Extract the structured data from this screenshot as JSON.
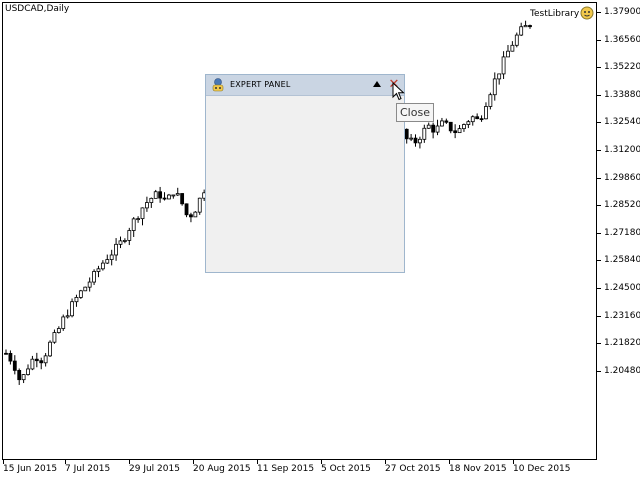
{
  "chart": {
    "symbol": "USDCAD,Daily",
    "expert_name": "TestLibrary",
    "price_labels": [
      "1.37900",
      "1.36560",
      "1.35220",
      "1.33880",
      "1.32540",
      "1.31200",
      "1.29860",
      "1.28520",
      "1.27180",
      "1.25840",
      "1.24500",
      "1.23160",
      "1.21820",
      "1.20480"
    ],
    "time_labels": [
      "15 Jun 2015",
      "7 Jul 2015",
      "29 Jul 2015",
      "20 Aug 2015",
      "11 Sep 2015",
      "5 Oct 2015",
      "27 Oct 2015",
      "18 Nov 2015",
      "10 Dec 2015"
    ],
    "colors": {
      "candle": "#000000",
      "background": "#ffffff"
    }
  },
  "chart_data": {
    "type": "candlestick",
    "title": "USDCAD,Daily",
    "ylim": [
      1.1985,
      1.3835
    ],
    "x": [
      "15 Jun 2015",
      "7 Jul 2015",
      "29 Jul 2015",
      "20 Aug 2015",
      "11 Sep 2015",
      "5 Oct 2015",
      "27 Oct 2015",
      "18 Nov 2015",
      "10 Dec 2015"
    ],
    "approx_close_series": [
      1.232,
      1.228,
      1.219,
      1.226,
      1.231,
      1.229,
      1.236,
      1.241,
      1.248,
      1.253,
      1.258,
      1.262,
      1.266,
      1.271,
      1.275,
      1.278,
      1.282,
      1.288,
      1.293,
      1.298,
      1.301,
      1.303,
      1.299,
      1.304,
      1.3,
      1.292,
      1.296,
      1.303,
      1.311,
      1.316,
      1.318,
      1.312,
      1.309,
      1.305,
      1.299,
      1.296,
      1.301,
      1.306,
      1.311,
      1.315,
      1.318,
      1.322,
      1.324,
      1.321,
      1.318,
      1.312,
      1.308,
      1.311,
      1.316,
      1.321,
      1.325,
      1.328,
      1.331,
      1.329,
      1.333,
      1.327,
      1.325,
      1.329,
      1.333,
      1.331,
      1.334,
      1.332,
      1.33,
      1.334,
      1.337,
      1.335,
      1.344,
      1.352,
      1.359,
      1.366,
      1.372,
      1.376,
      1.378
    ]
  },
  "panel": {
    "title": "EXPERT PANEL",
    "tooltip": "Close",
    "icons": {
      "app": "robot-icon",
      "minimize": "triangle-up-icon",
      "close": "close-icon",
      "cursor": "pointer-cursor-icon"
    }
  }
}
